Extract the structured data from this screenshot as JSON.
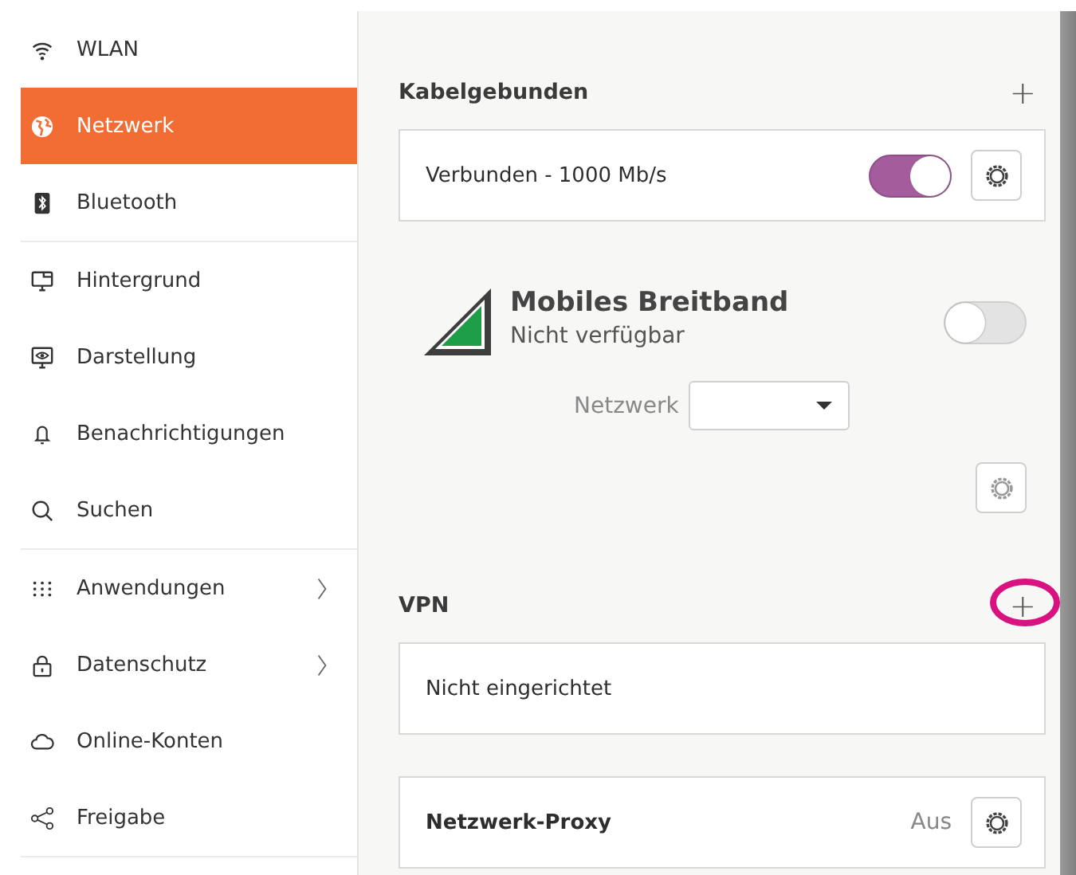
{
  "sidebar": {
    "items": [
      {
        "label": "WLAN",
        "kind": "wifi",
        "selected": false,
        "chevron": false,
        "divider_after": false
      },
      {
        "label": "Netzwerk",
        "kind": "globe",
        "selected": true,
        "chevron": false,
        "divider_after": false
      },
      {
        "label": "Bluetooth",
        "kind": "bluetooth",
        "selected": false,
        "chevron": false,
        "divider_after": true
      },
      {
        "label": "Hintergrund",
        "kind": "monitor",
        "selected": false,
        "chevron": false,
        "divider_after": false
      },
      {
        "label": "Darstellung",
        "kind": "display",
        "selected": false,
        "chevron": false,
        "divider_after": false
      },
      {
        "label": "Benachrichtigungen",
        "kind": "bell",
        "selected": false,
        "chevron": false,
        "divider_after": false
      },
      {
        "label": "Suchen",
        "kind": "search",
        "selected": false,
        "chevron": false,
        "divider_after": true
      },
      {
        "label": "Anwendungen",
        "kind": "grid",
        "selected": false,
        "chevron": true,
        "divider_after": false
      },
      {
        "label": "Datenschutz",
        "kind": "lock",
        "selected": false,
        "chevron": true,
        "divider_after": false
      },
      {
        "label": "Online-Konten",
        "kind": "cloud",
        "selected": false,
        "chevron": false,
        "divider_after": false
      },
      {
        "label": "Freigabe",
        "kind": "share",
        "selected": false,
        "chevron": false,
        "divider_after": true
      }
    ]
  },
  "wired": {
    "title": "Kabelgebunden",
    "add": "+",
    "connection": {
      "label": "Verbunden - 1000 Mb/s",
      "on": true
    }
  },
  "mobile": {
    "title": "Mobiles Breitband",
    "subtitle": "Nicht verfügbar",
    "on": false,
    "network_label": "Netzwerk"
  },
  "vpn": {
    "title": "VPN",
    "add": "+",
    "highlighted": true,
    "empty_text": "Nicht eingerichtet"
  },
  "proxy": {
    "title": "Netzwerk-Proxy",
    "status": "Aus"
  }
}
